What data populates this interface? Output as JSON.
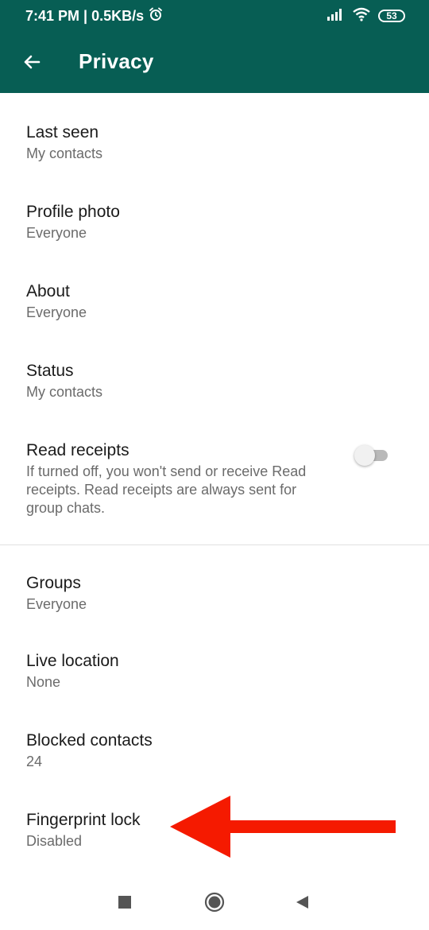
{
  "status_bar": {
    "time_speed": "7:41 PM | 0.5KB/s",
    "battery": "53"
  },
  "app_bar": {
    "title": "Privacy"
  },
  "settings": [
    {
      "title": "Last seen",
      "value": "My contacts"
    },
    {
      "title": "Profile photo",
      "value": "Everyone"
    },
    {
      "title": "About",
      "value": "Everyone"
    },
    {
      "title": "Status",
      "value": "My contacts"
    },
    {
      "title": "Read receipts",
      "value": "If turned off, you won't send or receive Read receipts. Read receipts are always sent for group chats.",
      "toggle_on": false
    },
    {
      "title": "Groups",
      "value": "Everyone"
    },
    {
      "title": "Live location",
      "value": "None"
    },
    {
      "title": "Blocked contacts",
      "value": "24"
    },
    {
      "title": "Fingerprint lock",
      "value": "Disabled"
    }
  ],
  "colors": {
    "header": "#075e54",
    "annotation_arrow": "#f51a00"
  },
  "icons": {
    "back": "arrow-left-icon",
    "alarm": "alarm-icon",
    "signal": "signal-icon",
    "wifi": "wifi-icon",
    "battery": "battery-icon",
    "nav_recents": "square-icon",
    "nav_home": "circle-icon",
    "nav_back": "triangle-back-icon"
  }
}
